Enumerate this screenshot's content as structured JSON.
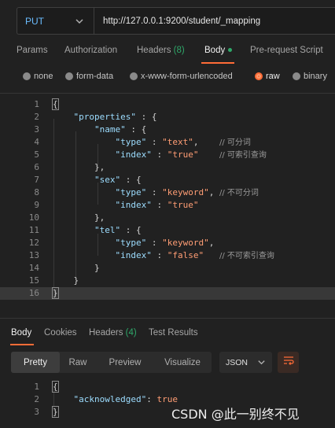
{
  "request": {
    "method": "PUT",
    "url": "http://127.0.0.1:9200/student/_mapping"
  },
  "req_tabs": {
    "params": "Params",
    "authorization": "Authorization",
    "headers": "Headers",
    "headers_count": "(8)",
    "body": "Body",
    "pre_request": "Pre-request Script"
  },
  "body_types": {
    "none": "none",
    "form_data": "form-data",
    "urlencoded": "x-www-form-urlencoded",
    "raw": "raw",
    "binary": "binary",
    "selected": "raw"
  },
  "editor": {
    "line_numbers": [
      "1",
      "2",
      "3",
      "4",
      "5",
      "6",
      "7",
      "8",
      "9",
      "10",
      "11",
      "12",
      "13",
      "14",
      "15",
      "16"
    ],
    "properties_key": "\"properties\"",
    "name_key": "\"name\"",
    "sex_key": "\"sex\"",
    "tel_key": "\"tel\"",
    "type_key": "\"type\"",
    "index_key": "\"index\"",
    "text_val": "\"text\"",
    "keyword_val": "\"keyword\"",
    "true_val": "\"true\"",
    "false_val": "\"false\"",
    "comment_can_split": "// 可分词",
    "comment_can_index": "// 可索引查询",
    "comment_no_split": "// 不可分词",
    "comment_no_index": "// 不可索引查询"
  },
  "resp_tabs": {
    "body": "Body",
    "cookies": "Cookies",
    "headers": "Headers",
    "headers_count": "(4)",
    "tests": "Test Results"
  },
  "resp_toolbar": {
    "pretty": "Pretty",
    "raw": "Raw",
    "preview": "Preview",
    "visualize": "Visualize",
    "format": "JSON"
  },
  "response": {
    "line_numbers": [
      "1",
      "2",
      "3"
    ],
    "key": "\"acknowledged\"",
    "value": "true"
  },
  "watermark": "CSDN @此一别终不见",
  "colors": {
    "accent": "#ff6c37",
    "count_green": "#2fa86a",
    "method_blue": "#6bbcff",
    "json_key": "#9cdcfe",
    "json_string": "#ff9d74"
  }
}
